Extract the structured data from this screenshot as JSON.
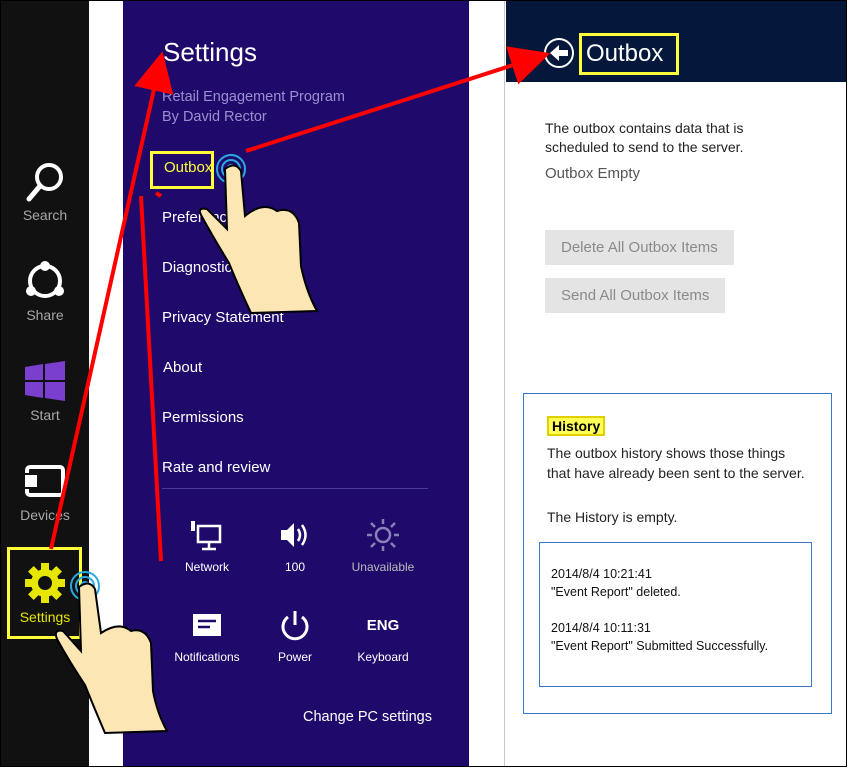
{
  "charms": [
    {
      "label": "Search",
      "icon": "search-icon"
    },
    {
      "label": "Share",
      "icon": "share-icon"
    },
    {
      "label": "Start",
      "icon": "windows-logo-icon"
    },
    {
      "label": "Devices",
      "icon": "devices-icon"
    },
    {
      "label": "Settings",
      "icon": "gear-icon"
    }
  ],
  "settings": {
    "title": "Settings",
    "app_name": "Retail Engagement Program",
    "app_author": "By David Rector",
    "menu": [
      "Outbox",
      "Preferences",
      "Diagnostics",
      "Privacy Statement",
      "About",
      "Permissions",
      "Rate and review"
    ],
    "quick_settings": [
      {
        "label": "Network",
        "icon": "network-icon"
      },
      {
        "label": "100",
        "icon": "volume-icon"
      },
      {
        "label": "Unavailable",
        "icon": "brightness-icon"
      },
      {
        "label": "Notifications",
        "icon": "notifications-icon"
      },
      {
        "label": "Power",
        "icon": "power-icon"
      },
      {
        "label": "Keyboard",
        "icon_text": "ENG"
      }
    ],
    "change_pc_settings": "Change PC settings"
  },
  "outbox": {
    "title": "Outbox",
    "description": "The outbox contains data that is scheduled to send to the server.",
    "status": "Outbox Empty",
    "delete_button": "Delete All Outbox Items",
    "send_button": "Send All Outbox Items",
    "history": {
      "title": "History",
      "description": "The outbox history shows those things that have already been sent to the server.",
      "empty_text": "The History is empty.",
      "log": [
        {
          "timestamp": "2014/8/4 10:21:41",
          "message": "\"Event Report\" deleted."
        },
        {
          "timestamp": "2014/8/4 10:11:31",
          "message": "\"Event Report\" Submitted Successfully."
        }
      ]
    }
  },
  "colors": {
    "charms_bg": "#111111",
    "settings_bg": "#1f0a6b",
    "flyout_header_bg": "#05173a",
    "highlight": "#ffff3a",
    "annotation_arrow": "#ff0000",
    "history_border": "#3b78c9"
  }
}
